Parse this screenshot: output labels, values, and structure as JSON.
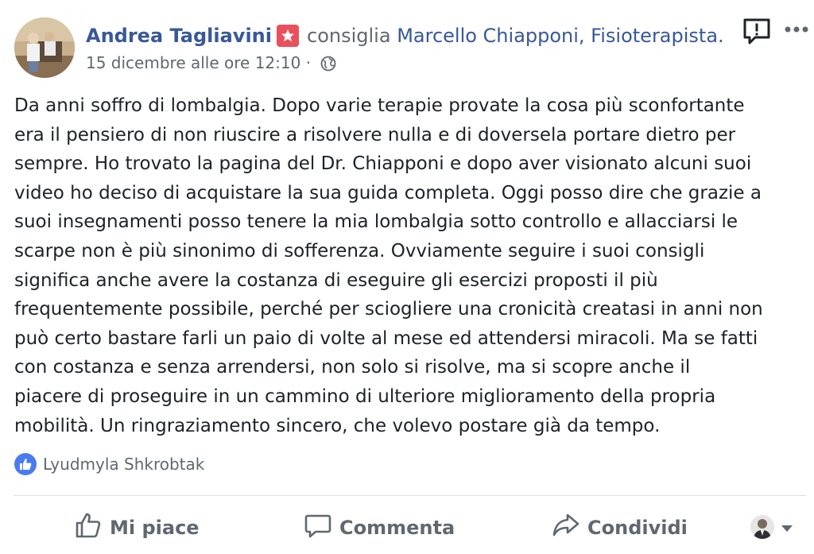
{
  "post": {
    "author": "Andrea Tagliavini",
    "verb": "consiglia",
    "target": "Marcello Chiapponi, Fisioterapista.",
    "timestamp": "15 dicembre alle ore 12:10",
    "separator": "·",
    "privacy_icon": "globe-icon",
    "badge_icon": "star-icon",
    "text_lines": [
      "Da anni soffro di lombalgia. Dopo varie terapie provate la cosa più sconfortante",
      "era il pensiero di non riuscire a risolvere nulla e di doversela portare dietro per",
      "sempre. Ho trovato la pagina del Dr. Chiapponi e dopo aver visionato alcuni suoi",
      "video ho deciso di acquistare la sua guida completa. Oggi posso dire che grazie a",
      "suoi insegnamenti posso tenere la mia lombalgia sotto controllo e allacciarsi le",
      "scarpe non è più sinonimo di sofferenza. Ovviamente seguire i suoi consigli",
      "significa anche avere la costanza di eseguire gli esercizi proposti il più",
      "frequentemente possibile, perché per sciogliere una cronicità creatasi in anni non",
      "può certo bastare farli un paio di volte al mese ed attendersi miracoli. Ma se fatti",
      "con costanza e senza arrendersi, non solo si risolve, ma si scopre anche il",
      "piacere di proseguire in un cammino di ulteriore miglioramento della propria",
      "mobilità. Un ringraziamento sincero, che volevo postare già da tempo."
    ]
  },
  "reactions": {
    "icon": "like-icon",
    "names": "Lyudmyla Shkrobtak"
  },
  "actions": {
    "like_label": "Mi piace",
    "comment_label": "Commenta",
    "share_label": "Condividi"
  },
  "colors": {
    "link": "#385898",
    "secondary_text": "#616770",
    "badge": "#e9505c",
    "like_blue": "#4a7bf0",
    "divider": "#dadde1"
  }
}
